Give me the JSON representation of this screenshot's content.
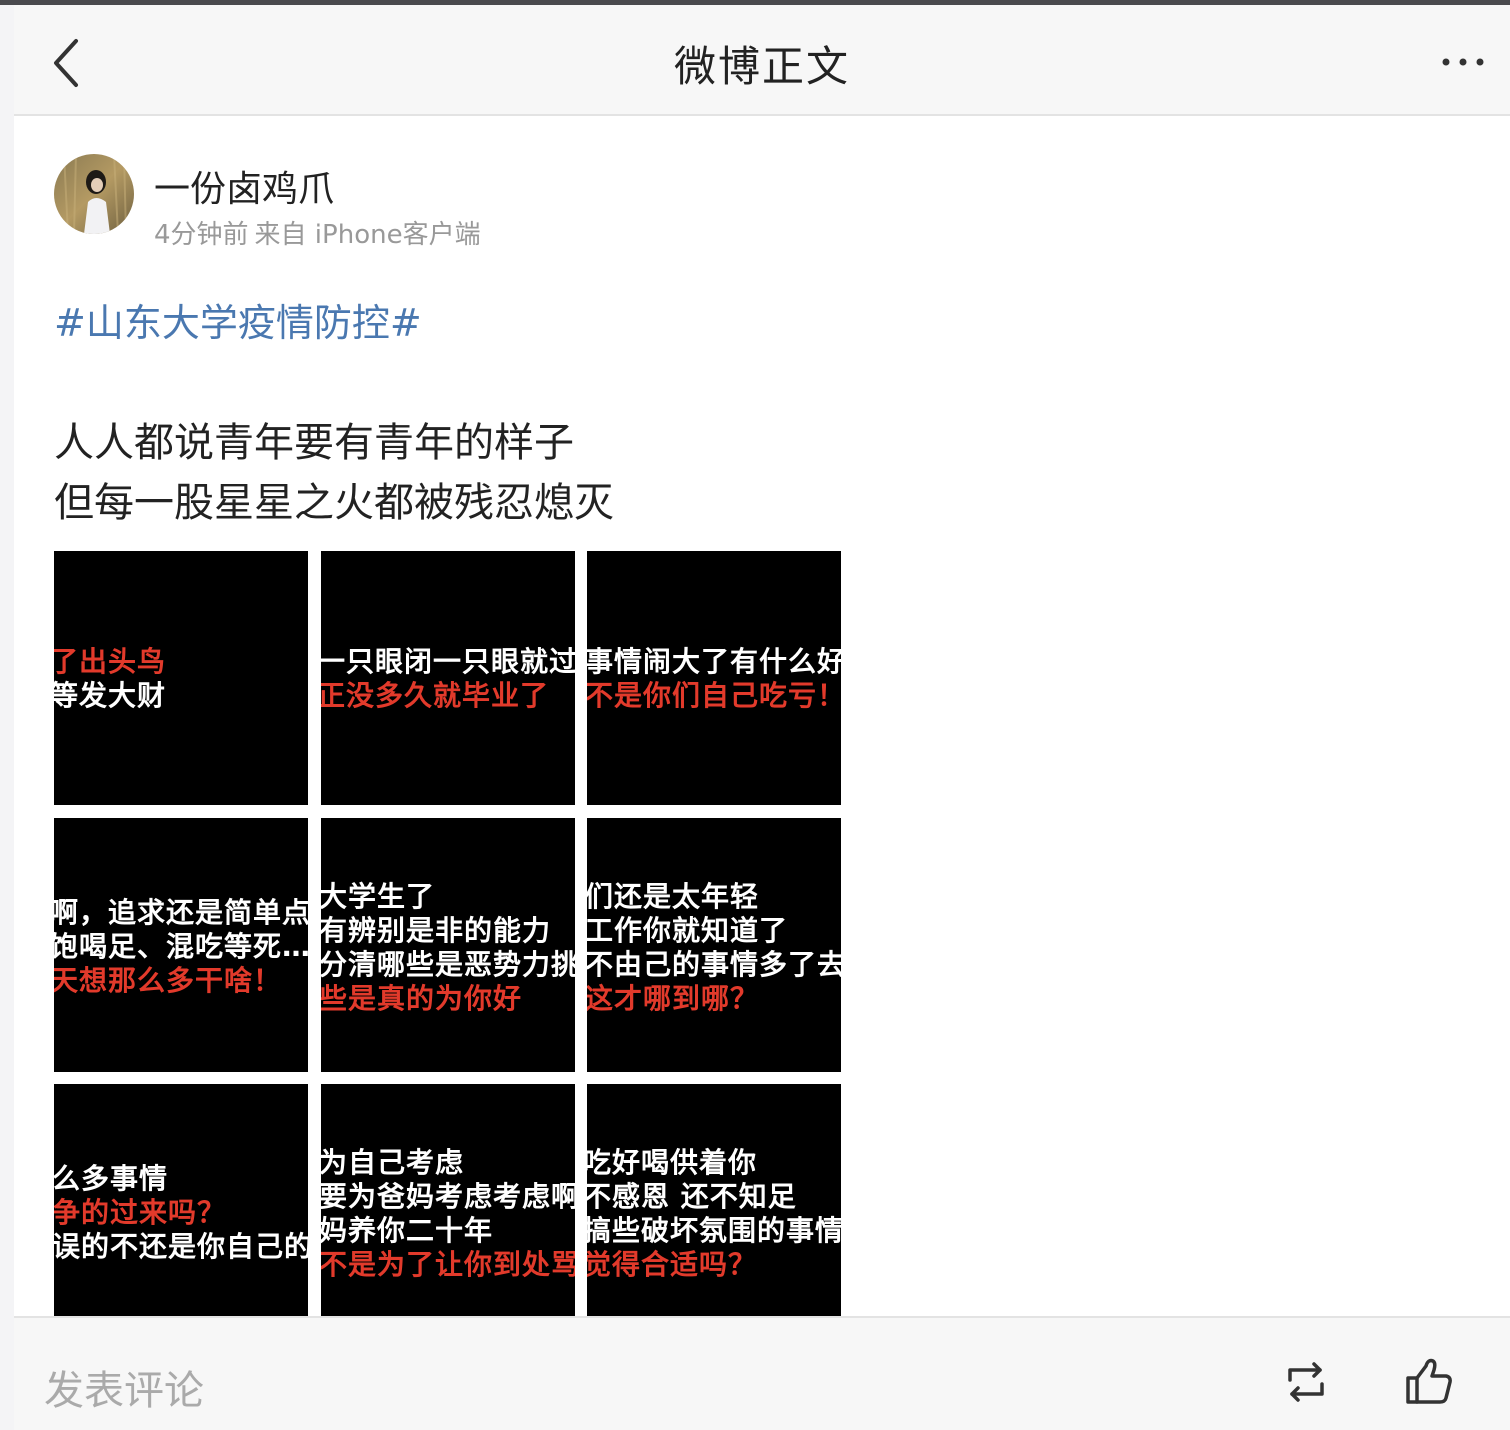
{
  "header": {
    "title": "微博正文",
    "back_icon": "chevron-left-icon",
    "more_icon": "more-horizontal-icon"
  },
  "author": {
    "name": "一份卤鸡爪",
    "time": "4分钟前",
    "source": "来自 iPhone客户端"
  },
  "post": {
    "hashtag": "#山东大学疫情防控#",
    "lines": [
      "人人都说青年要有青年的样子",
      "但每一股星星之火都被残忍熄灭"
    ]
  },
  "images": [
    {
      "lines": [
        {
          "text": "了出头鸟",
          "color": "red"
        },
        {
          "text": "等发大财",
          "color": "white"
        }
      ]
    },
    {
      "lines": [
        {
          "text": "一只眼闭一只眼就过去",
          "color": "white"
        },
        {
          "text": "正没多久就毕业了",
          "color": "red"
        }
      ]
    },
    {
      "lines": [
        {
          "text": "事情闹大了有什么好处",
          "color": "white"
        },
        {
          "text": "不是你们自己吃亏！",
          "color": "red"
        }
      ]
    },
    {
      "lines": [
        {
          "text": "啊，追求还是简单点",
          "color": "white"
        },
        {
          "text": "饱喝足、混吃等死…",
          "color": "white"
        },
        {
          "text": "天想那么多干啥！",
          "color": "red"
        }
      ]
    },
    {
      "lines": [
        {
          "text": "大学生了",
          "color": "white"
        },
        {
          "text": "有辨别是非的能力",
          "color": "white"
        },
        {
          "text": "分清哪些是恶势力挑",
          "color": "white"
        },
        {
          "text": "些是真的为你好",
          "color": "red"
        }
      ]
    },
    {
      "lines": [
        {
          "text": "们还是太年轻",
          "color": "white"
        },
        {
          "text": "工作你就知道了",
          "color": "white"
        },
        {
          "text": "不由己的事情多了去",
          "color": "white"
        },
        {
          "text": "这才哪到哪？",
          "color": "red"
        }
      ]
    },
    {
      "lines": [
        {
          "text": "么多事情",
          "color": "white"
        },
        {
          "text": "争的过来吗？",
          "color": "red"
        },
        {
          "text": "误的不还是你自己的",
          "color": "white"
        }
      ]
    },
    {
      "lines": [
        {
          "text": "为自己考虑",
          "color": "white"
        },
        {
          "text": "要为爸妈考虑考虑啊",
          "color": "white"
        },
        {
          "text": "妈养你二十年",
          "color": "white"
        },
        {
          "text": "不是为了让你到处骂",
          "color": "red"
        }
      ]
    },
    {
      "lines": [
        {
          "text": "吃好喝供着你",
          "color": "white"
        },
        {
          "text": "不感恩 还不知足",
          "color": "white"
        },
        {
          "text": "搞些破坏氛围的事情",
          "color": "white"
        },
        {
          "text": "觉得合适吗？",
          "color": "red"
        }
      ]
    }
  ],
  "bottom": {
    "comment_placeholder": "发表评论",
    "repost_icon": "repost-icon",
    "like_icon": "thumbs-up-icon"
  },
  "colors": {
    "hashtag": "#4a78b0",
    "red_text": "#e23a2b",
    "bar_bg": "#f7f7f7"
  }
}
